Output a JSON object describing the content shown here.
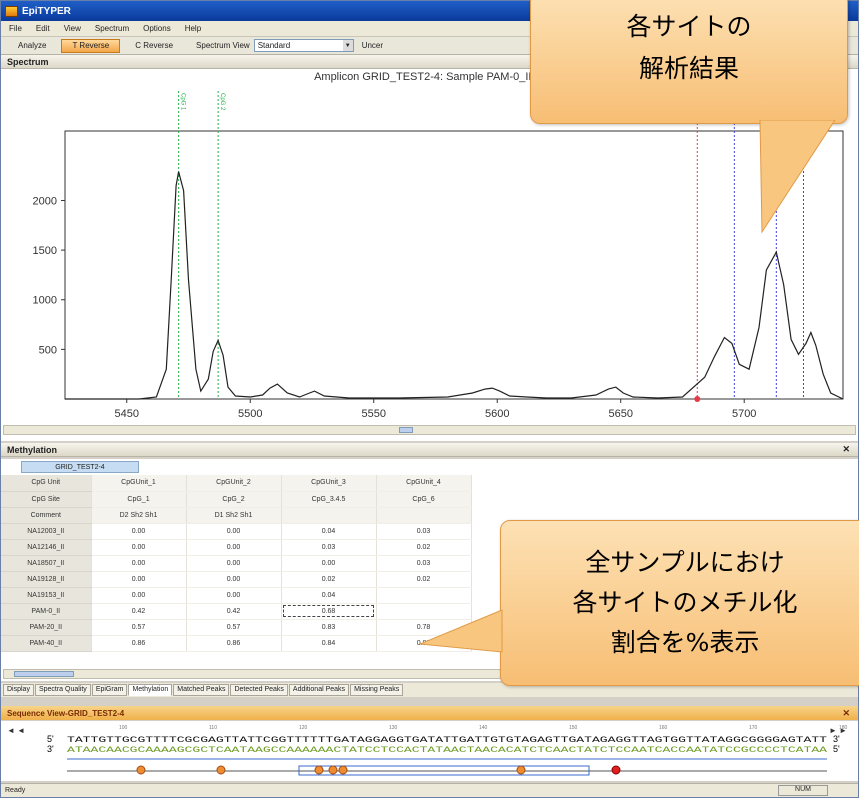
{
  "window": {
    "title": "EpiTYPER"
  },
  "menu": [
    "File",
    "Edit",
    "View",
    "Spectrum",
    "Options",
    "Help"
  ],
  "toolbar": {
    "buttons": [
      "Analyze",
      "T Reverse",
      "C Reverse"
    ],
    "spectrum_view_label": "Spectrum View",
    "spectrum_view_value": "Standard",
    "truncated_label": "Uncer"
  },
  "spectrum": {
    "panel_title": "Spectrum",
    "chart_title": "Amplicon GRID_TEST2-4: Sample PAM-0_II: S"
  },
  "chart_data": {
    "type": "line",
    "title": "Amplicon GRID_TEST2-4: Sample PAM-0_II: S",
    "xlabel": "",
    "ylabel": "",
    "xlim": [
      5425,
      5740
    ],
    "ylim": [
      0,
      2700
    ],
    "x_ticks": [
      5450,
      5500,
      5550,
      5600,
      5650,
      5700
    ],
    "y_ticks": [
      500,
      1000,
      1500,
      2000
    ],
    "series": [
      {
        "x": [
          5425,
          5455,
          5462,
          5466,
          5468,
          5470,
          5471,
          5473,
          5475,
          5478,
          5480,
          5483,
          5485,
          5487,
          5489,
          5491,
          5494,
          5500,
          5505,
          5508,
          5511,
          5515,
          5520,
          5523,
          5526,
          5530,
          5540,
          5550,
          5560,
          5570,
          5580,
          5590,
          5595,
          5598,
          5601,
          5605,
          5612,
          5620,
          5630,
          5640,
          5645,
          5648,
          5651,
          5655,
          5665,
          5675,
          5684,
          5688,
          5692,
          5695,
          5698,
          5702,
          5706,
          5709,
          5713,
          5716,
          5719,
          5722,
          5725,
          5727,
          5729,
          5732,
          5735,
          5740
        ],
        "y": [
          0,
          0,
          20,
          300,
          1200,
          2150,
          2290,
          2100,
          1200,
          300,
          80,
          200,
          480,
          590,
          440,
          120,
          30,
          20,
          40,
          110,
          150,
          60,
          20,
          50,
          80,
          30,
          10,
          10,
          10,
          15,
          20,
          60,
          100,
          110,
          80,
          30,
          20,
          10,
          10,
          40,
          100,
          120,
          60,
          20,
          10,
          20,
          220,
          430,
          620,
          560,
          350,
          300,
          720,
          1300,
          1480,
          1150,
          600,
          450,
          560,
          670,
          540,
          250,
          60,
          0
        ]
      }
    ],
    "markers": [
      {
        "label": "CpG 1",
        "x": 5471,
        "color": "#23b34a"
      },
      {
        "label": "CpG 2",
        "x": 5487,
        "color": "#23b34a"
      },
      {
        "label": "CpG 3",
        "x": 5681,
        "color": "#e8384a"
      },
      {
        "label": "CpG 4",
        "x": 5696,
        "color": "#4040e0"
      },
      {
        "label": "CpG 5",
        "x": 5713,
        "color": "#4040e0"
      },
      {
        "label": "CpG 6",
        "x": 5724,
        "color": "#4040e0"
      }
    ],
    "grid": false
  },
  "methylation": {
    "panel_title": "Methylation",
    "tab": "GRID_TEST2-4",
    "row_headers": [
      "CpG Unit",
      "CpG Site",
      "Comment",
      "NA12003_II",
      "NA12146_II",
      "NA18507_II",
      "NA19128_II",
      "NA19153_II",
      "PAM-0_II",
      "PAM-20_II",
      "PAM-40_II"
    ],
    "columns": [
      [
        "CpGUnit_1",
        "CpG_1",
        "D2 Sh2 Sh1",
        "0.00",
        "0.00",
        "0.00",
        "0.00",
        "0.00",
        "0.42",
        "0.57",
        "0.86"
      ],
      [
        "CpGUnit_2",
        "CpG_2",
        "D1 Sh2 Sh1",
        "0.00",
        "0.00",
        "0.00",
        "0.00",
        "0.00",
        "0.42",
        "0.57",
        "0.86"
      ],
      [
        "CpGUnit_3",
        "CpG_3.4.5",
        "",
        "0.04",
        "0.03",
        "0.00",
        "0.02",
        "0.04",
        "0.68",
        "0.83",
        "0.84"
      ],
      [
        "CpGUnit_4",
        "CpG_6",
        "",
        "0.03",
        "0.02",
        "0.03",
        "0.02",
        "",
        "",
        "0.78",
        "0.88"
      ]
    ]
  },
  "tabs": [
    "Display",
    "Spectra Quality",
    "EpiGram",
    "Methylation",
    "Matched Peaks",
    "Detected Peaks",
    "Additional Peaks",
    "Missing Peaks"
  ],
  "active_tab": "Methylation",
  "sequence": {
    "panel_title": "Sequence View-GRID_TEST2-4",
    "top_strand": "TATTGTTGCGTTTTCGCGAGTTATTCGGTTTTTTGATAGGAGGTGATATTGATTGTGTAGAGTTGATAGAGGTTAGTGGTTATAGGCGGGGAGTATT",
    "bottom_strand": "ATAACAACGCAAAAGCGCTCAATAAGCCAAAAAACTATCCTCCACTATAACTAACACATCTCAACTATCTCCAATCACCAATATCCGCCCCTCATAA",
    "five_prime": "5'",
    "three_prime": "3'",
    "ruler": [
      "100",
      "110",
      "120",
      "130",
      "140",
      "150",
      "160",
      "170",
      "180"
    ]
  },
  "status": {
    "left": "Ready",
    "right": "NUM"
  },
  "callouts": {
    "top": [
      "各サイトの",
      "解析結果"
    ],
    "bottom": [
      "全サンプルにおけ",
      "各サイトのメチル化",
      "割合を%表示"
    ]
  }
}
